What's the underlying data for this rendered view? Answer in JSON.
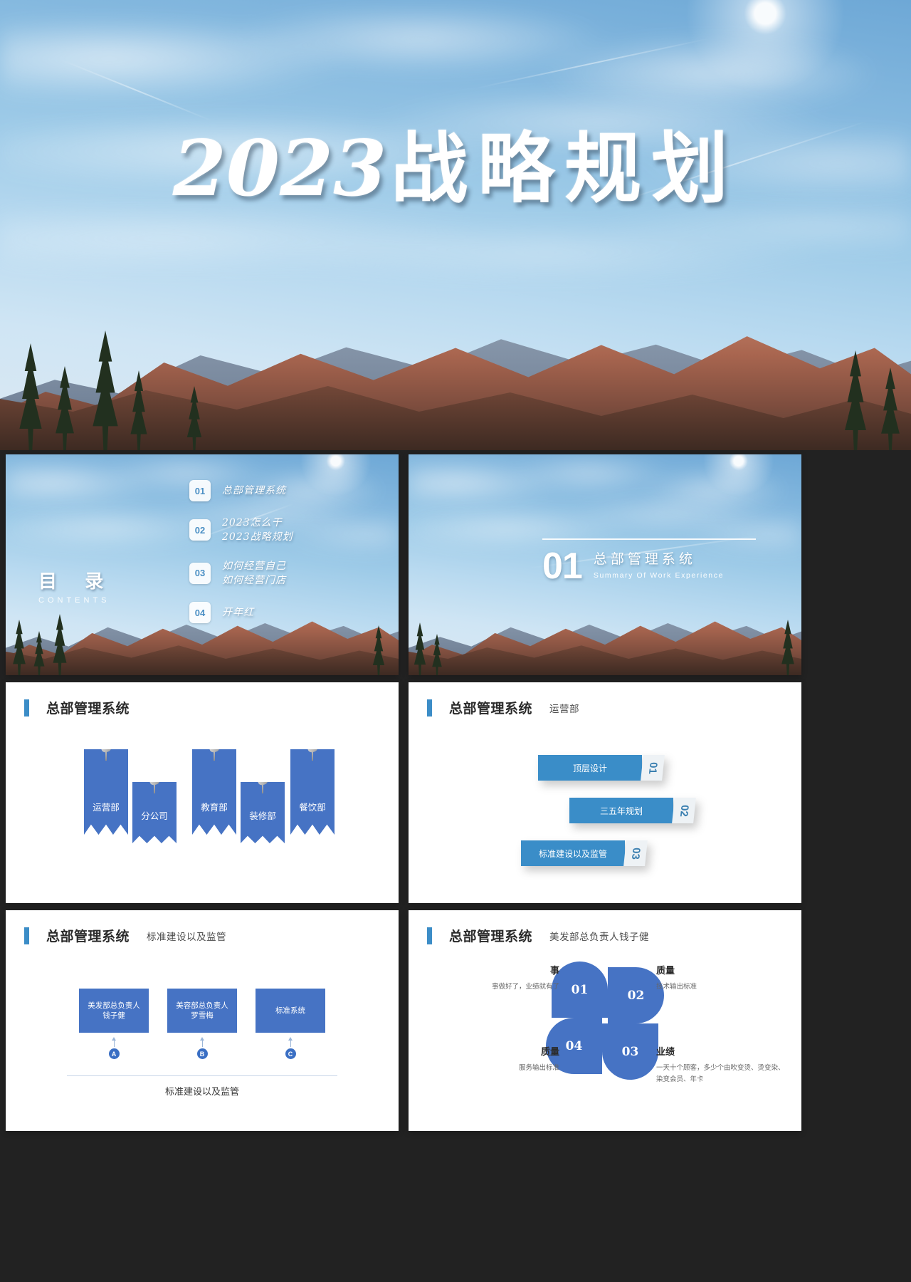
{
  "deck": {
    "title_slide": {
      "year": "2023",
      "title_cn": "战略规划"
    },
    "contents_slide": {
      "label_cn": "目 录",
      "label_en": "CONTENTS",
      "items": [
        {
          "num": "01",
          "lines": [
            "总部管理系统"
          ]
        },
        {
          "num": "02",
          "lines": [
            "2023怎么干",
            "2023战略规划"
          ]
        },
        {
          "num": "03",
          "lines": [
            "如何经营自己",
            "如何经营门店"
          ]
        },
        {
          "num": "04",
          "lines": [
            "开年红"
          ]
        }
      ]
    },
    "section_slide": {
      "num": "01",
      "title_cn": "总部管理系统",
      "title_en": "Summary Of Work Experience"
    },
    "slide_departments": {
      "header_title": "总部管理系统",
      "banners": [
        {
          "label": "运营部",
          "tall": true
        },
        {
          "label": "分公司",
          "tall": false
        },
        {
          "label": "教育部",
          "tall": true
        },
        {
          "label": "装修部",
          "tall": false
        },
        {
          "label": "餐饮部",
          "tall": true
        }
      ]
    },
    "slide_operations": {
      "header_title": "总部管理系统",
      "header_sub": "运营部",
      "bars": [
        {
          "num": "01",
          "label": "顶层设计"
        },
        {
          "num": "02",
          "label": "三五年规划"
        },
        {
          "num": "03",
          "label": "标准建设以及监管"
        }
      ]
    },
    "slide_standards": {
      "header_title": "总部管理系统",
      "header_sub": "标准建设以及监管",
      "caption": "标准建设以及监管",
      "boxes": [
        {
          "marker": "A",
          "lines": [
            "美发部总负责人",
            "钱子健"
          ]
        },
        {
          "marker": "B",
          "lines": [
            "美容部总负责人",
            "罗雪梅"
          ]
        },
        {
          "marker": "C",
          "lines": [
            "标准系统"
          ]
        }
      ]
    },
    "slide_pinwheel": {
      "header_title": "总部管理系统",
      "header_sub": "美发部总负责人钱子健",
      "quadrants": [
        {
          "num": "01"
        },
        {
          "num": "02"
        },
        {
          "num": "03"
        },
        {
          "num": "04"
        }
      ],
      "labels": {
        "top_left": {
          "title": "事",
          "desc": "事做好了，业绩就有了"
        },
        "top_right": {
          "title": "质量",
          "desc": "技术输出标准"
        },
        "bottom_left": {
          "title": "质量",
          "desc": "服务输出标准"
        },
        "bottom_right": {
          "title": "业绩",
          "desc": "一天十个顾客，多少个由吹变烫、烫变染、染变会员、年卡"
        }
      }
    },
    "colors": {
      "accent_blue": "#3c8dc7",
      "box_blue": "#4673c4",
      "bar_blue": "#3a8dc8"
    }
  }
}
